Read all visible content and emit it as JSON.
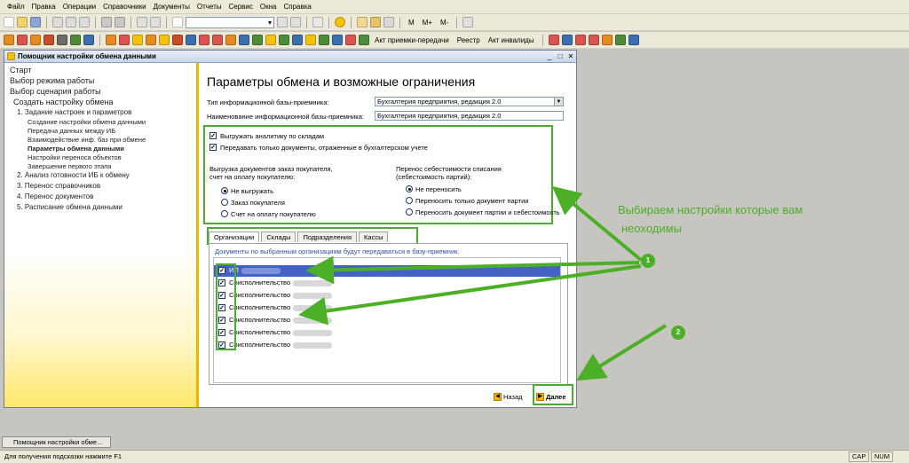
{
  "menu": [
    "Файл",
    "Правка",
    "Операции",
    "Справочники",
    "Документы",
    "Отчеты",
    "Сервис",
    "Окна",
    "Справка"
  ],
  "toolbar1": {
    "labels": [
      "M",
      "M+",
      "M-"
    ]
  },
  "toolbar2": {
    "labels": [
      "Акт приемки-передачи",
      "Реестр",
      "Акт инвалиды"
    ]
  },
  "window": {
    "title": "Помощник настройки обмена данными"
  },
  "steps": [
    "Старт",
    "Выбор режима работы",
    "Выбор сценария работы",
    "Создать настройку обмена",
    "1. Задание настроек и параметров",
    "Создание настройки обмена данными",
    "Передача данных между ИБ",
    "Взаимодействие инф. баз при обмене",
    "Параметры обмена данными",
    "Настройки переноса объектов",
    "Завершение первого этапа",
    "2. Анализ готовности ИБ к обмену",
    "3. Перенос справочников",
    "4. Перенос документов",
    "5. Расписание обмена данными"
  ],
  "form": {
    "title": "Параметры обмена и возможные ограничения",
    "type_label": "Тип информационной базы-приемника:",
    "type_value": "Бухгалтерия предприятия, редакция 2.0",
    "name_label": "Наименование информационной базы-приемника:",
    "name_value": "Бухгалтерия предприятия, редакция 2.0",
    "cb_analytics": "Выгружать аналитику по складам",
    "cb_docs_only": "Передавать только документы, отраженные в бухгалтерском учете",
    "group1_title_1": "Выгрузка документов заказ покупателя,",
    "group1_title_2": "счет на оплату покупателю:",
    "group1_options": [
      "Не выгружать",
      "Заказ покупателя",
      "Счет на оплату покупателю"
    ],
    "group2_title_1": "Перенос себестоимости списания",
    "group2_title_2": "(себестоимость партий):",
    "group2_options": [
      "Не переносить",
      "Переносить только документ партии",
      "Переносить документ партии и себестоимость"
    ],
    "tabs": [
      "Организации",
      "Склады",
      "Подразделения",
      "Кассы"
    ],
    "info": "Документы по выбранным организациям будут передаваться в базу-приемник.",
    "orgs": [
      "ИП",
      "Соисполнительство",
      "Соисполнительство",
      "Соисполнительство",
      "Соисполнительство",
      "Соисполнительство",
      "Соисполнительство"
    ],
    "back": "Назад",
    "next": "Далее"
  },
  "annotation": {
    "line1": "Выбираем настройки которые вам",
    "line2": "неоходимы",
    "badge1": "1",
    "badge2": "2"
  },
  "taskbar_item": "Помощник настройки обме...",
  "status": {
    "hint": "Для получения подсказки нажмите F1",
    "cap": "CAP",
    "num": "NUM"
  },
  "colors": {
    "accent_green": "#4caf28",
    "selection_blue": "#4461c4",
    "left_pane_yellow": "#ffe76a"
  }
}
